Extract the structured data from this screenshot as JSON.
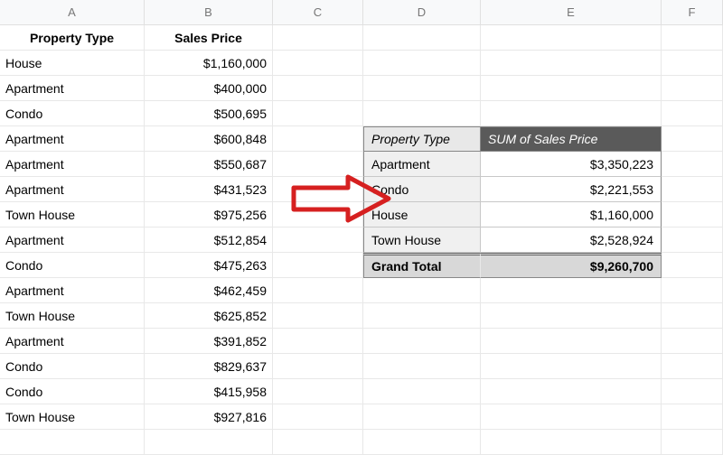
{
  "columns": [
    "A",
    "B",
    "C",
    "D",
    "E",
    "F"
  ],
  "main_headers": {
    "property_type": "Property Type",
    "sales_price": "Sales Price"
  },
  "rows": [
    {
      "type": "House",
      "price": "$1,160,000"
    },
    {
      "type": "Apartment",
      "price": "$400,000"
    },
    {
      "type": "Condo",
      "price": "$500,695"
    },
    {
      "type": "Apartment",
      "price": "$600,848"
    },
    {
      "type": "Apartment",
      "price": "$550,687"
    },
    {
      "type": "Apartment",
      "price": "$431,523"
    },
    {
      "type": "Town House",
      "price": "$975,256"
    },
    {
      "type": "Apartment",
      "price": "$512,854"
    },
    {
      "type": "Condo",
      "price": "$475,263"
    },
    {
      "type": "Apartment",
      "price": "$462,459"
    },
    {
      "type": "Town House",
      "price": "$625,852"
    },
    {
      "type": "Apartment",
      "price": "$391,852"
    },
    {
      "type": "Condo",
      "price": "$829,637"
    },
    {
      "type": "Condo",
      "price": "$415,958"
    },
    {
      "type": "Town House",
      "price": "$927,816"
    }
  ],
  "pivot": {
    "header_label": "Property Type",
    "header_sum": "SUM of Sales Price",
    "rows": [
      {
        "label": "Apartment",
        "value": "$3,350,223"
      },
      {
        "label": "Condo",
        "value": "$2,221,553"
      },
      {
        "label": "House",
        "value": "$1,160,000"
      },
      {
        "label": "Town House",
        "value": "$2,528,924"
      }
    ],
    "total_label": "Grand Total",
    "total_value": "$9,260,700"
  }
}
